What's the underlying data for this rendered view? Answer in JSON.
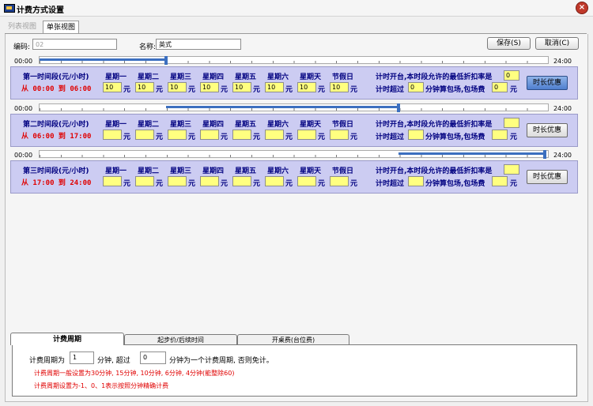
{
  "window": {
    "title": "计费方式设置",
    "close_icon": "close-icon"
  },
  "view_tabs": [
    "列表视图",
    "单张视图"
  ],
  "form": {
    "code_label": "编码:",
    "code_value": "02",
    "name_label": "名称:",
    "name_value": "英式"
  },
  "buttons": {
    "save": "保存(S)",
    "cancel": "取消(C)"
  },
  "ruler": {
    "start": "00:00",
    "end": "24:00"
  },
  "days": [
    "星期一",
    "星期二",
    "星期三",
    "星期四",
    "星期五",
    "星期六",
    "星期天",
    "节假日"
  ],
  "unit": "元",
  "periods": [
    {
      "title": "第一时间段(元/小时)",
      "range": "从 00:00 到 06:00",
      "prices": [
        "10",
        "10",
        "10",
        "10",
        "10",
        "10",
        "10",
        "10"
      ],
      "min_discount": "0",
      "overtime_minutes": "0",
      "package_fee": "0",
      "fill_from_hours": 0,
      "fill_to_hours": 6,
      "marker_hours": [
        6
      ]
    },
    {
      "title": "第二时间段(元/小时)",
      "range": "从 06:00 到 17:00",
      "prices": [
        "",
        "",
        "",
        "",
        "",
        "",
        "",
        ""
      ],
      "min_discount": "",
      "overtime_minutes": "",
      "package_fee": "",
      "fill_from_hours": 6,
      "fill_to_hours": 17,
      "marker_hours": [
        17
      ]
    },
    {
      "title": "第三时间段(元/小时)",
      "range": "从 17:00 到 24:00",
      "prices": [
        "",
        "",
        "",
        "",
        "",
        "",
        "",
        ""
      ],
      "min_discount": "",
      "overtime_minutes": "",
      "package_fee": "",
      "fill_from_hours": 17,
      "fill_to_hours": 24,
      "marker_hours": [
        24
      ]
    }
  ],
  "row_labels": {
    "discount": "计时开台,本时段允许的最低折扣率是",
    "overtime_pre": "计时超过",
    "overtime_post": "分钟算包场,包场费",
    "unit": "元",
    "promo_button": "时长优惠"
  },
  "bottom_tabs": [
    "计费周期",
    "起步价/后续时间",
    "开桌费(台位费)"
  ],
  "cycle": {
    "pre": "计费周期为",
    "value": "1",
    "mid": "分钟, 超过",
    "threshold": "0",
    "post": "分钟为一个计费周期, 否则免计。",
    "note1": "计费周期一般设置为30分钟, 15分钟, 10分钟, 6分钟, 4分钟(能整除60)",
    "note2": "计费周期设置为-1、0、1表示按照分钟精确计费"
  }
}
